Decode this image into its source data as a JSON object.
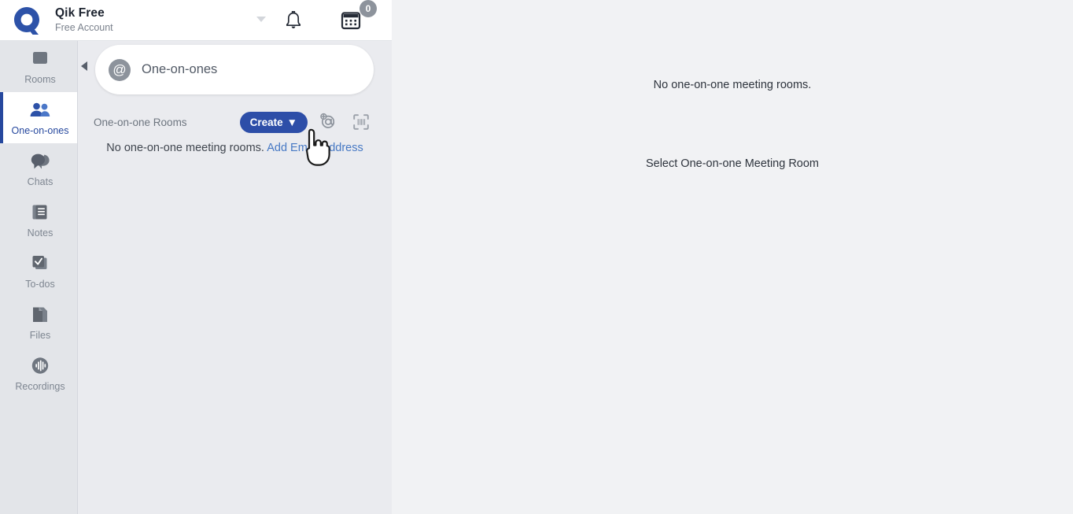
{
  "header": {
    "logo_icon": "q-logo-icon",
    "account_name": "Qik Free",
    "account_subtitle": "Free Account",
    "account_caret_icon": "chevron-down-icon",
    "bell_icon": "notification-bell-icon",
    "calendar_icon": "calendar-icon",
    "calendar_badge": "0"
  },
  "sidebar": {
    "items": [
      {
        "label": "Rooms",
        "icon": "rooms-icon",
        "active": false
      },
      {
        "label": "One-on-ones",
        "icon": "people-icon",
        "active": true
      },
      {
        "label": "Chats",
        "icon": "chat-bubble-icon",
        "active": false
      },
      {
        "label": "Notes",
        "icon": "notes-icon",
        "active": false
      },
      {
        "label": "To-dos",
        "icon": "checkbox-icon",
        "active": false
      },
      {
        "label": "Files",
        "icon": "files-icon",
        "active": false
      },
      {
        "label": "Recordings",
        "icon": "recording-icon",
        "active": false
      }
    ]
  },
  "list_panel": {
    "collapse_icon": "collapse-left-arrow-icon",
    "search_card": {
      "avatar_glyph": "@",
      "avatar_icon": "at-avatar-icon",
      "title": "One-on-ones"
    },
    "toolbar": {
      "label": "One-on-one Rooms",
      "create_label": "Create",
      "create_caret": "▼",
      "add_email_icon": "add-email-icon",
      "scan_icon": "scan-code-icon"
    },
    "empty_state": {
      "message": "No one-on-one meeting rooms.",
      "link_label": "Add Email Address"
    }
  },
  "right_pane": {
    "empty_message": "No one-on-one meeting rooms.",
    "select_prompt": "Select One-on-one Meeting Room"
  },
  "cursor": {
    "icon": "pointing-hand-cursor-icon"
  },
  "colors": {
    "accent_blue": "#2d4ea8",
    "link_blue": "#4779c4",
    "active_border": "#26489e",
    "icon_gray": "#7e8691",
    "rail_bg": "#e3e5e9",
    "list_bg": "#eaebef",
    "right_bg": "#f1f2f4"
  }
}
